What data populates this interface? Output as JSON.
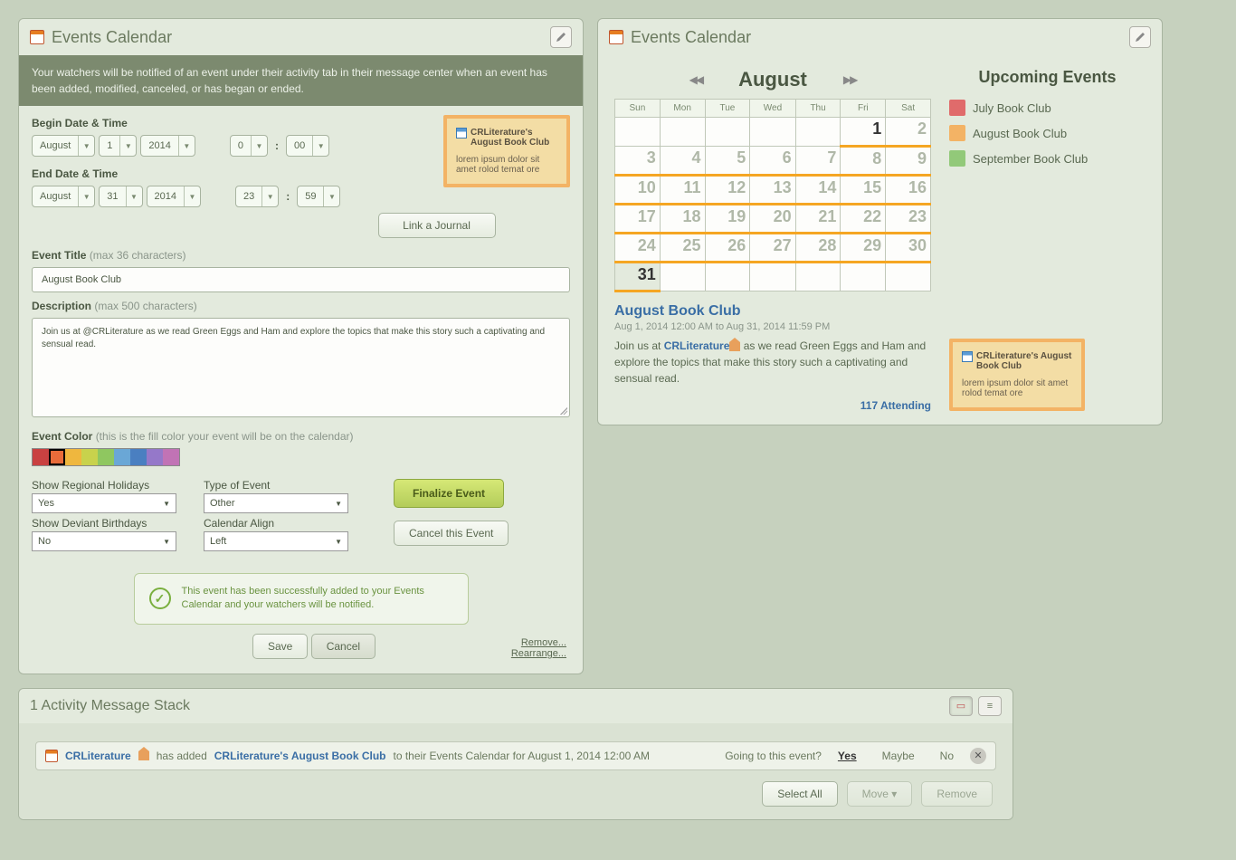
{
  "left": {
    "panel_title": "Events Calendar",
    "info": "Your watchers will be notified of an event under their activity tab in their message center when an event has been added, modified, canceled, or has began or ended.",
    "begin_label": "Begin Date & Time",
    "end_label": "End Date & Time",
    "begin": {
      "month": "August",
      "day": "1",
      "year": "2014",
      "hour": "0",
      "min": "00"
    },
    "end": {
      "month": "August",
      "day": "31",
      "year": "2014",
      "hour": "23",
      "min": "59"
    },
    "title_label": "Event Title",
    "title_hint": "(max 36 characters)",
    "title_value": "August Book Club",
    "desc_label": "Description",
    "desc_hint": "(max 500 characters)",
    "desc_value": "Join us at @CRLiterature as we read Green Eggs and Ham and explore the topics that make this story such a captivating and sensual read.",
    "color_label": "Event Color",
    "color_hint": "(this is the fill color your event will be on the calendar)",
    "colors": [
      "#c94141",
      "#e86b3a",
      "#efb73e",
      "#c8d24c",
      "#8fc760",
      "#6aa7d6",
      "#4a7fc1",
      "#9578c9",
      "#c173b5"
    ],
    "selected_color_index": 1,
    "holidays_label": "Show Regional Holidays",
    "holidays_value": "Yes",
    "birthdays_label": "Show Deviant Birthdays",
    "birthdays_value": "No",
    "type_label": "Type of Event",
    "type_value": "Other",
    "align_label": "Calendar Align",
    "align_value": "Left",
    "link_journal_btn": "Link a Journal",
    "finalize_btn": "Finalize Event",
    "cancel_event_btn": "Cancel this Event",
    "success_msg": "This event has been successfully added to your Events Calendar and your watchers will be notified.",
    "save_btn": "Save",
    "cancel_btn": "Cancel",
    "remove_link": "Remove...",
    "rearrange_link": "Rearrange...",
    "preview": {
      "title": "CRLiterature's August Book Club",
      "body": "lorem ipsum dolor sit amet rolod temat ore"
    }
  },
  "right": {
    "panel_title": "Events Calendar",
    "month": "August",
    "days_header": [
      "Sun",
      "Mon",
      "Tue",
      "Wed",
      "Thu",
      "Fri",
      "Sat"
    ],
    "weeks": [
      [
        {
          "n": ""
        },
        {
          "n": ""
        },
        {
          "n": ""
        },
        {
          "n": ""
        },
        {
          "n": ""
        },
        {
          "n": "1",
          "hl": true,
          "today": true
        },
        {
          "n": "2",
          "hl": true
        }
      ],
      [
        {
          "n": "3",
          "hl": true
        },
        {
          "n": "4",
          "hl": true
        },
        {
          "n": "5",
          "hl": true
        },
        {
          "n": "6",
          "hl": true
        },
        {
          "n": "7",
          "hl": true
        },
        {
          "n": "8",
          "hl": true
        },
        {
          "n": "9",
          "hl": true
        }
      ],
      [
        {
          "n": "10",
          "hl": true
        },
        {
          "n": "11",
          "hl": true
        },
        {
          "n": "12",
          "hl": true
        },
        {
          "n": "13",
          "hl": true
        },
        {
          "n": "14",
          "hl": true
        },
        {
          "n": "15",
          "hl": true
        },
        {
          "n": "16",
          "hl": true
        }
      ],
      [
        {
          "n": "17",
          "hl": true
        },
        {
          "n": "18",
          "hl": true
        },
        {
          "n": "19",
          "hl": true
        },
        {
          "n": "20",
          "hl": true
        },
        {
          "n": "21",
          "hl": true
        },
        {
          "n": "22",
          "hl": true
        },
        {
          "n": "23",
          "hl": true
        }
      ],
      [
        {
          "n": "24",
          "hl": true
        },
        {
          "n": "25",
          "hl": true
        },
        {
          "n": "26",
          "hl": true
        },
        {
          "n": "27",
          "hl": true
        },
        {
          "n": "28",
          "hl": true
        },
        {
          "n": "29",
          "hl": true
        },
        {
          "n": "30",
          "hl": true
        }
      ],
      [
        {
          "n": "31",
          "hl": true,
          "dark": true
        },
        {
          "n": ""
        },
        {
          "n": ""
        },
        {
          "n": ""
        },
        {
          "n": ""
        },
        {
          "n": ""
        },
        {
          "n": ""
        }
      ]
    ],
    "upcoming_title": "Upcoming Events",
    "legend": [
      {
        "color": "#e06b6b",
        "label": "July Book Club"
      },
      {
        "color": "#f3b365",
        "label": "August Book Club"
      },
      {
        "color": "#92c979",
        "label": "September Book Club"
      }
    ],
    "event": {
      "title": "August Book Club",
      "date": "Aug 1, 2014 12:00 AM to Aug 31, 2014 11:59 PM",
      "desc_pre": "Join us at ",
      "desc_link": "CRLiterature",
      "desc_post": " as we read Green Eggs and Ham and explore the topics that make this story such a captivating and sensual read.",
      "attending": "117 Attending"
    },
    "preview": {
      "title": "CRLiterature's August Book Club",
      "body": "lorem ipsum dolor sit amet rolod temat ore"
    }
  },
  "activity": {
    "title": "1 Activity Message Stack",
    "row": {
      "user": "CRLiterature",
      "mid1": " has added ",
      "event": "CRLiterature's August Book Club",
      "mid2": " to their Events Calendar for August 1, 2014 12:00 AM",
      "question": "Going to this event?",
      "yes": "Yes",
      "maybe": "Maybe",
      "no": "No"
    },
    "select_all": "Select All",
    "move": "Move",
    "remove": "Remove"
  }
}
